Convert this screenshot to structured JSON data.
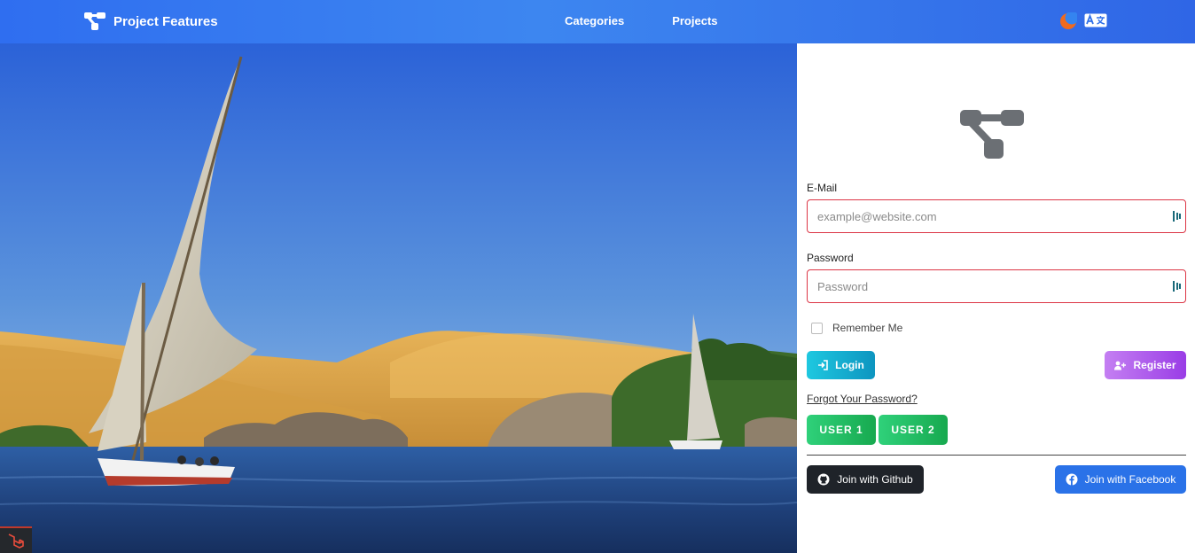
{
  "nav": {
    "brand": "Project Features",
    "links": [
      "Categories",
      "Projects"
    ],
    "icons": [
      "moon-icon",
      "translate-icon"
    ]
  },
  "hero": {
    "image": "felucca sailboats on the Nile river with golden sand dunes and blue sky"
  },
  "form": {
    "email_label": "E-Mail",
    "email_placeholder": "example@website.com",
    "password_label": "Password",
    "password_placeholder": "Password",
    "remember_label": "Remember Me",
    "login_label": "Login",
    "register_label": "Register",
    "forgot_label": "Forgot Your Password?",
    "user1_label": "USER 1",
    "user2_label": "USER 2",
    "github_label": "Join with Github",
    "facebook_label": "Join with Facebook"
  },
  "colors": {
    "navbar": "#3a7ef0",
    "input_border": "#dc3545",
    "login": "#12aed6",
    "register": "#ad5cec",
    "user": "#22be63",
    "github": "#1f2329",
    "facebook": "#2a72e8"
  }
}
